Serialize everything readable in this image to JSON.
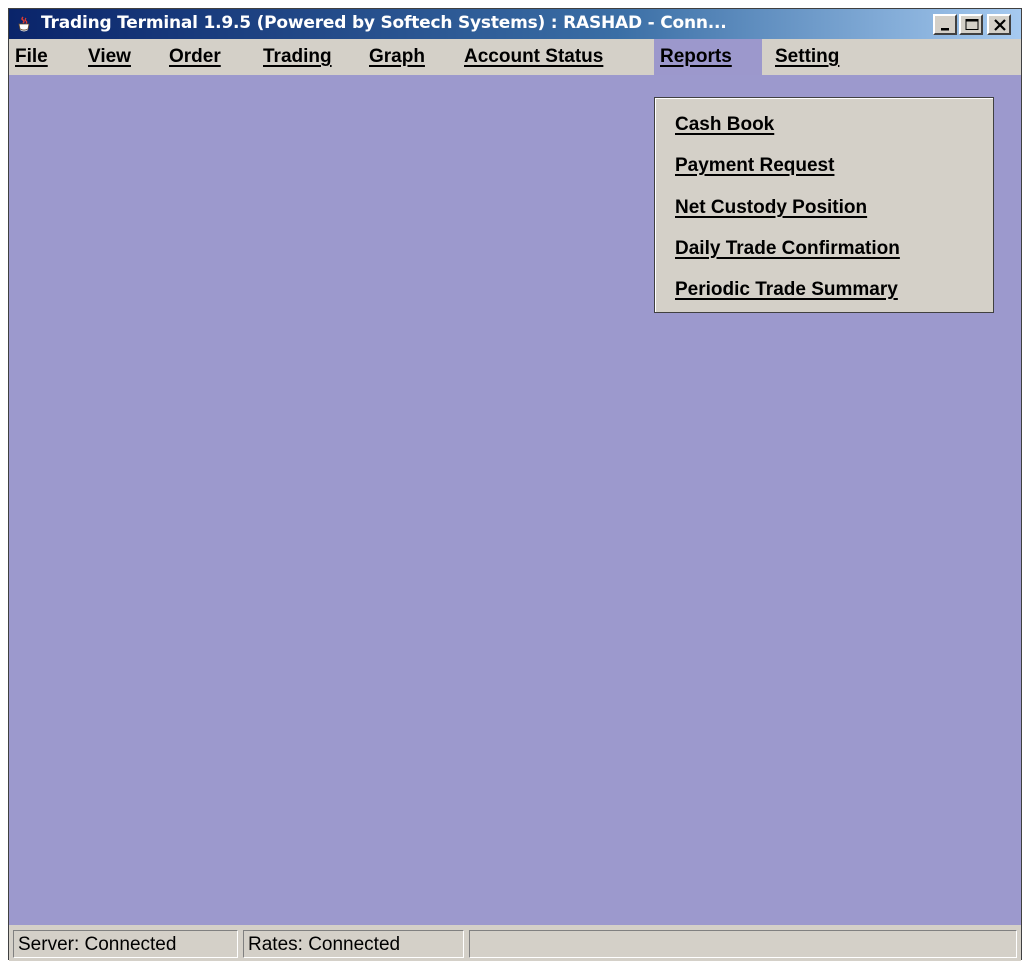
{
  "window": {
    "title": "Trading Terminal 1.9.5 (Powered by Softech Systems)   :   RASHAD - Conn...",
    "app_icon": "java-cup-icon",
    "controls": [
      "minimize-icon",
      "maximize-icon",
      "close-icon"
    ]
  },
  "menubar": {
    "items": [
      {
        "label": "File"
      },
      {
        "label": "View"
      },
      {
        "label": "Order"
      },
      {
        "label": "Trading"
      },
      {
        "label": "Graph"
      },
      {
        "label": "Account Status"
      },
      {
        "label": "Reports"
      },
      {
        "label": "Setting"
      }
    ],
    "active": "Reports"
  },
  "reports_menu": {
    "items": [
      {
        "label": "Cash Book"
      },
      {
        "label": "Payment Request"
      },
      {
        "label": "Net Custody Position"
      },
      {
        "label": "Daily Trade Confirmation"
      },
      {
        "label": "Periodic Trade Summary"
      }
    ]
  },
  "statusbar": {
    "server": "Server: Connected",
    "rates": "Rates: Connected",
    "message": ""
  },
  "colors": {
    "desktop": "#9c99cd",
    "menu_active": "#9c98cc",
    "chrome": "#d4d0c8",
    "titlebar_start": "#0a246a",
    "titlebar_end": "#a6caf0"
  }
}
